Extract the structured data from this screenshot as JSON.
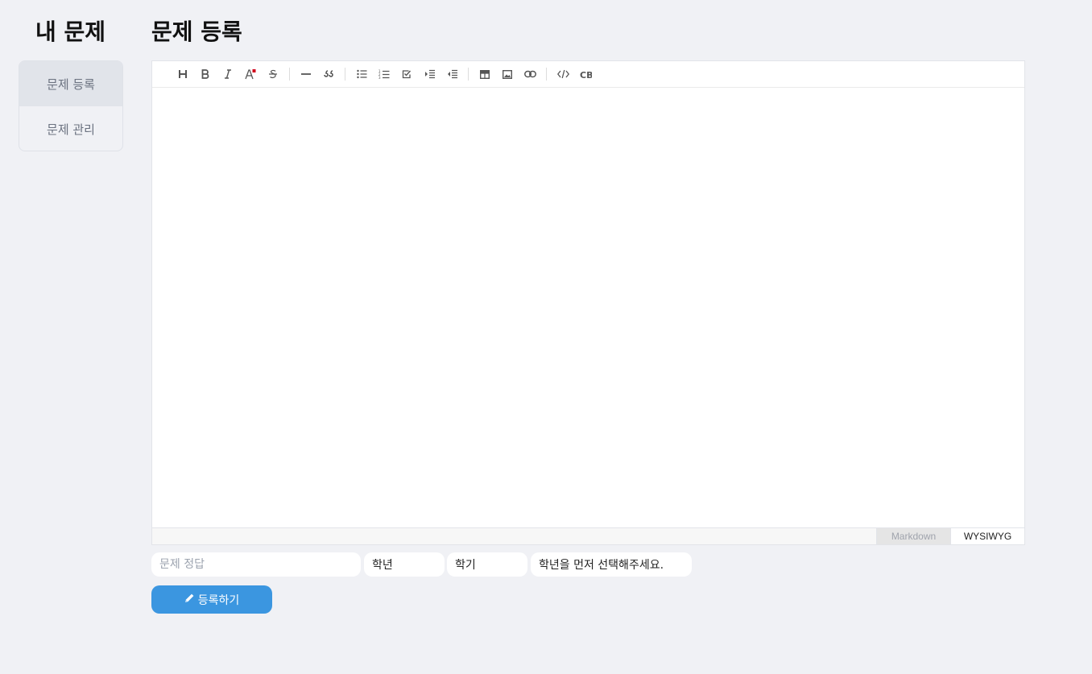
{
  "sidebar": {
    "title": "내 문제",
    "items": [
      {
        "label": "문제 등록",
        "active": true
      },
      {
        "label": "문제 관리",
        "active": false
      }
    ]
  },
  "main": {
    "title": "문제 등록"
  },
  "editor": {
    "toolbar_icons": [
      "heading-icon",
      "bold-icon",
      "italic-icon",
      "text-color-icon",
      "strikethrough-icon",
      "horizontal-rule-icon",
      "quote-icon",
      "bullet-list-icon",
      "ordered-list-icon",
      "task-list-icon",
      "indent-icon",
      "outdent-icon",
      "table-icon",
      "image-icon",
      "link-icon",
      "code-icon",
      "code-block-icon"
    ],
    "modes": {
      "markdown": "Markdown",
      "wysiwyg": "WYSIWYG"
    },
    "active_mode": "WYSIWYG",
    "accent_text_color": "#d0021b"
  },
  "form": {
    "answer_placeholder": "문제 정답",
    "grade_label": "학년",
    "semester_label": "학기",
    "unit_label": "학년을 먼저 선택해주세요.",
    "submit_label": "등록하기"
  },
  "colors": {
    "background": "#f0f1f5",
    "primary": "#3b96e0"
  }
}
